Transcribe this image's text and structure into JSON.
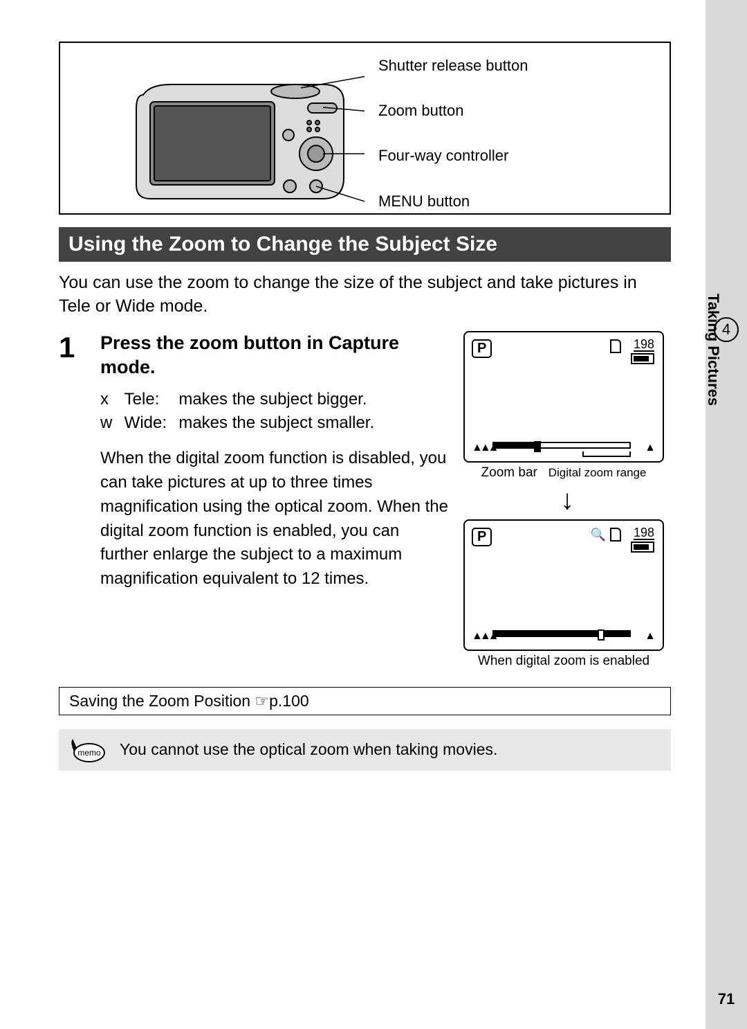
{
  "side_tab": {
    "chapter_num": "4",
    "chapter_title": "Taking Pictures"
  },
  "diagram": {
    "labels": {
      "shutter": "Shutter release button",
      "zoom": "Zoom button",
      "fourway": "Four-way controller",
      "menu": "MENU button"
    }
  },
  "section_title": "Using the Zoom to Change the Subject Size",
  "intro": "You can use the zoom to change the size of the subject and take pictures in Tele or Wide mode.",
  "step": {
    "num": "1",
    "title": "Press the zoom button in Capture mode.",
    "tele_sym": "x",
    "tele_label": "Tele:",
    "tele_desc": "makes the subject bigger.",
    "wide_sym": "w",
    "wide_label": "Wide:",
    "wide_desc": "makes the subject smaller.",
    "para": "When the digital zoom function is disabled, you can take pictures at up to three times magnification using the optical zoom. When the digital zoom function is enabled, you can further enlarge the subject to a maximum magnification equivalent to 12 times."
  },
  "lcd": {
    "mode": "P",
    "shots": "198",
    "zoom_bar_label": "Zoom bar",
    "digital_label": "Digital zoom range",
    "enabled_caption": "When digital zoom is enabled"
  },
  "ref_box": "Saving the Zoom Position ☞p.100",
  "memo": {
    "label": "memo",
    "text": "You cannot use the optical zoom when taking movies."
  },
  "page_num": "71"
}
